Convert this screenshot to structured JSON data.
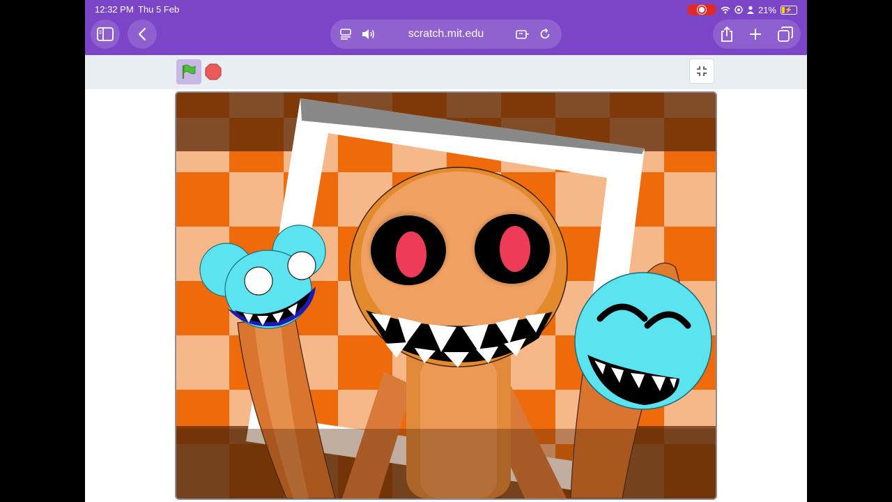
{
  "status_bar": {
    "time": "12:32 PM",
    "date": "Thu 5 Feb",
    "battery_percent": "21%",
    "battery_level": 0.21,
    "icons": [
      "screen-record-icon",
      "wifi-icon",
      "vpn-icon",
      "person-icon",
      "battery-charging-icon"
    ]
  },
  "browser": {
    "url": "scratch.mit.edu",
    "left_buttons": [
      "sidebar-icon",
      "back-chevron-icon"
    ],
    "url_icons_left": [
      "reader-icon",
      "speaker-icon"
    ],
    "url_icons_right": [
      "extension-icon",
      "reload-icon"
    ],
    "right_buttons": [
      "share-icon",
      "new-tab-plus-icon",
      "tabs-icon"
    ]
  },
  "scratch_player": {
    "green_flag": "green-flag-icon",
    "stop": "stop-sign-icon",
    "fullscreen": "exit-fullscreen-icon"
  },
  "colors": {
    "toolbar": "#7b45c8",
    "controls_bg": "#e9eef2",
    "checker_orange": "#ee6a0a",
    "checker_light": "#f6b789",
    "character_orange": "#f0a060",
    "blue_face": "#5ce3f0",
    "eye_red": "#ee3b57"
  }
}
